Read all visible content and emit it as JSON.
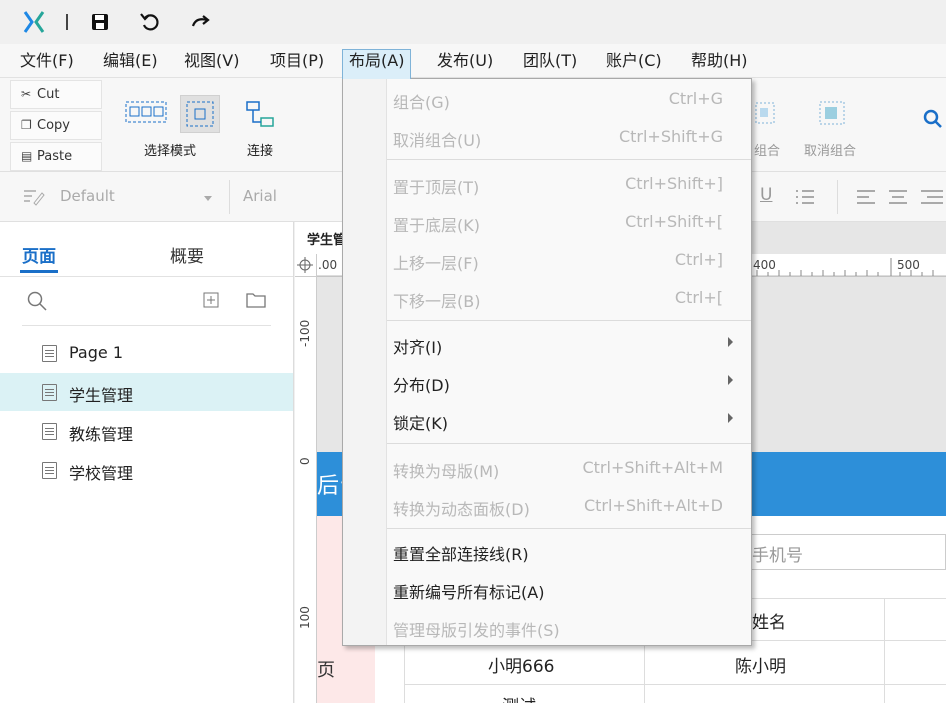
{
  "menubar": {
    "items": [
      "文件(F)",
      "编辑(E)",
      "视图(V)",
      "项目(P)",
      "布局(A)",
      "发布(U)",
      "团队(T)",
      "账户(C)",
      "帮助(H)"
    ]
  },
  "ribbon": {
    "cut": "Cut",
    "copy": "Copy",
    "paste": "Paste",
    "select_mode": "选择模式",
    "connect": "连接",
    "right_group": "组合",
    "right_ungroup": "取消组合"
  },
  "formatbar": {
    "style": "Default",
    "font": "Arial"
  },
  "leftpanel": {
    "tab_pages": "页面",
    "tab_overview": "概要",
    "pages": [
      "Page 1",
      "学生管理",
      "教练管理",
      "学校管理"
    ],
    "selected_index": 1
  },
  "canvas": {
    "doc_tab": "学生管",
    "ruler_top": [
      ".00",
      "400",
      "500"
    ],
    "ruler_left": [
      "-100",
      "0",
      "100"
    ],
    "band_text": "后台",
    "phone_placeholder": "手机号",
    "table_header": "姓名",
    "row1_col1": "小明666",
    "row1_col2": "陈小明",
    "row2_col1": "测试",
    "left_fragment": "页"
  },
  "layout_menu": {
    "items": [
      {
        "label": "组合(G)",
        "shortcut": "Ctrl+G",
        "enabled": false
      },
      {
        "label": "取消组合(U)",
        "shortcut": "Ctrl+Shift+G",
        "enabled": false
      },
      {
        "label": "置于顶层(T)",
        "shortcut": "Ctrl+Shift+]",
        "enabled": false
      },
      {
        "label": "置于底层(K)",
        "shortcut": "Ctrl+Shift+[",
        "enabled": false
      },
      {
        "label": "上移一层(F)",
        "shortcut": "Ctrl+]",
        "enabled": false
      },
      {
        "label": "下移一层(B)",
        "shortcut": "Ctrl+[",
        "enabled": false
      },
      {
        "label": "对齐(I)",
        "shortcut": "",
        "enabled": true,
        "submenu": true
      },
      {
        "label": "分布(D)",
        "shortcut": "",
        "enabled": true,
        "submenu": true
      },
      {
        "label": "锁定(K)",
        "shortcut": "",
        "enabled": true,
        "submenu": true
      },
      {
        "label": "转换为母版(M)",
        "shortcut": "Ctrl+Shift+Alt+M",
        "enabled": false
      },
      {
        "label": "转换为动态面板(D)",
        "shortcut": "Ctrl+Shift+Alt+D",
        "enabled": false
      },
      {
        "label": "重置全部连接线(R)",
        "shortcut": "",
        "enabled": true
      },
      {
        "label": "重新编号所有标记(A)",
        "shortcut": "",
        "enabled": true
      },
      {
        "label": "管理母版引发的事件(S)",
        "shortcut": "",
        "enabled": false
      }
    ]
  },
  "colors": {
    "accent": "#1a6fc8",
    "band": "#2d8fd9",
    "menu_active_bg": "#dbeef9",
    "page_selected_bg": "#dbf2f5"
  }
}
